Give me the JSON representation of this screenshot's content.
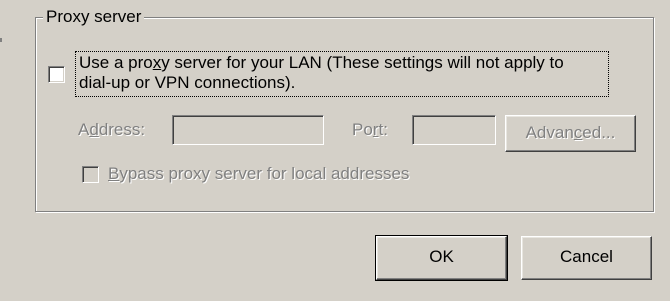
{
  "groupbox": {
    "title": "Proxy server"
  },
  "use_proxy": {
    "line1_a": "Use a pro",
    "line1_ul": "x",
    "line1_b": "y server for your LAN (These settings will not apply to",
    "line2": "dial-up or VPN connections).",
    "checked": false
  },
  "address": {
    "label_a": "A",
    "label_ul": "d",
    "label_b": "dress:",
    "value": ""
  },
  "port": {
    "label_a": "Po",
    "label_ul": "r",
    "label_b": "t:",
    "value": ""
  },
  "advanced_button": {
    "label_a": "Advan",
    "label_ul": "c",
    "label_b": "ed..."
  },
  "bypass": {
    "label_ul": "B",
    "label_b": "ypass proxy server for local addresses",
    "checked": false
  },
  "buttons": {
    "ok": "OK",
    "cancel": "Cancel"
  },
  "colors": {
    "face": "#d4d0c8",
    "disabled_text": "#808080"
  }
}
